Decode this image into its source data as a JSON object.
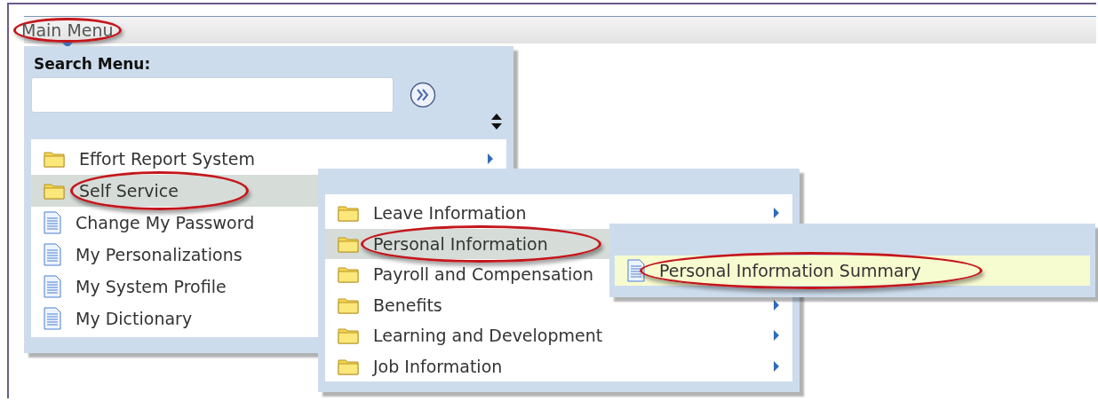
{
  "header": {
    "label": "Main Menu",
    "circled": true
  },
  "search": {
    "label": "Search Menu:"
  },
  "menus": [
    {
      "items": [
        {
          "label": "Effort Report System",
          "kind": "folder",
          "selected": false,
          "has_arrow": true,
          "circled": false
        },
        {
          "label": "Self Service",
          "kind": "folder",
          "selected": true,
          "has_arrow": false,
          "circled": true
        },
        {
          "label": "Change My Password",
          "kind": "page",
          "selected": false,
          "has_arrow": false,
          "circled": false
        },
        {
          "label": "My Personalizations",
          "kind": "page",
          "selected": false,
          "has_arrow": false,
          "circled": false
        },
        {
          "label": "My System Profile",
          "kind": "page",
          "selected": false,
          "has_arrow": false,
          "circled": false
        },
        {
          "label": "My Dictionary",
          "kind": "page",
          "selected": false,
          "has_arrow": false,
          "circled": false
        }
      ]
    },
    {
      "items": [
        {
          "label": "Leave Information",
          "kind": "folder",
          "selected": false,
          "has_arrow": true,
          "circled": false
        },
        {
          "label": "Personal Information",
          "kind": "folder",
          "selected": true,
          "has_arrow": false,
          "circled": true
        },
        {
          "label": "Payroll and Compensation",
          "kind": "folder",
          "selected": false,
          "has_arrow": false,
          "circled": false
        },
        {
          "label": "Benefits",
          "kind": "folder",
          "selected": false,
          "has_arrow": true,
          "circled": false
        },
        {
          "label": "Learning and Development",
          "kind": "folder",
          "selected": false,
          "has_arrow": true,
          "circled": false
        },
        {
          "label": "Job Information",
          "kind": "folder",
          "selected": false,
          "has_arrow": true,
          "circled": false
        }
      ]
    },
    {
      "items": [
        {
          "label": "Personal Information Summary",
          "kind": "page",
          "selected": true,
          "has_arrow": false,
          "circled": true
        }
      ]
    }
  ]
}
